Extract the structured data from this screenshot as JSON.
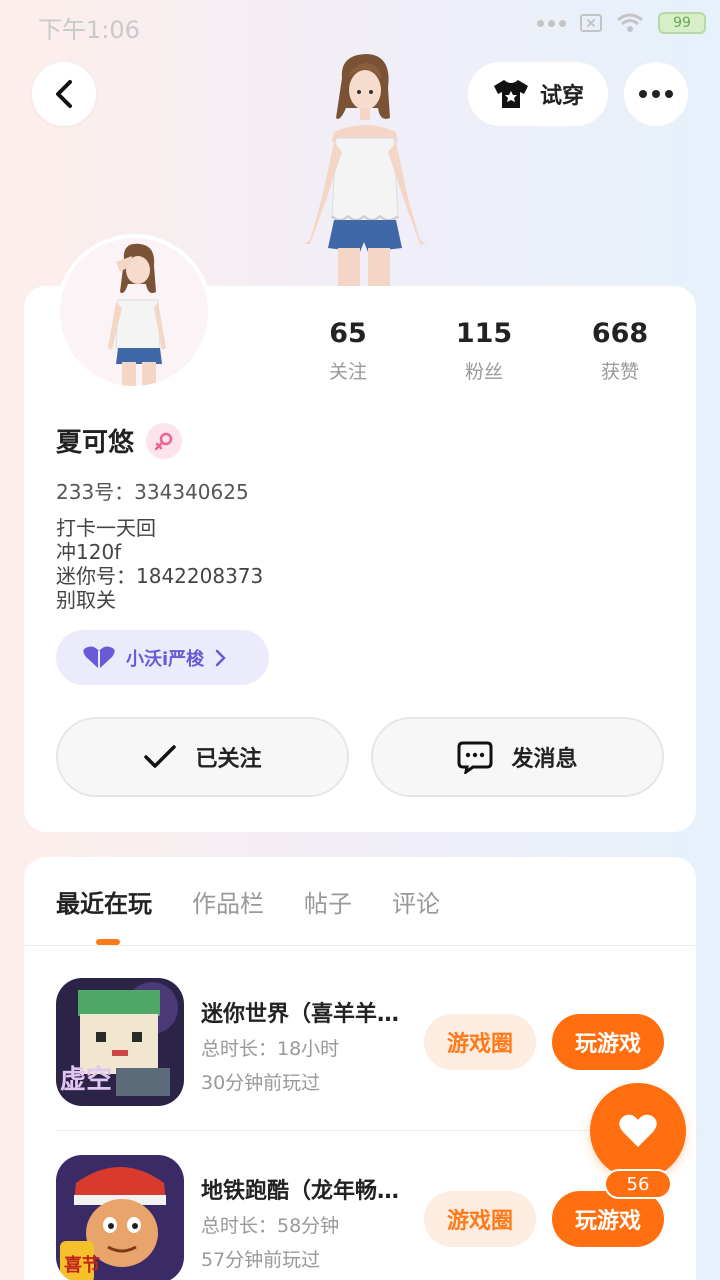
{
  "status_bar": {
    "time": "下午1:06",
    "battery": "99"
  },
  "header": {
    "tryon_label": "试穿"
  },
  "profile": {
    "stats": [
      {
        "value": "65",
        "label": "关注"
      },
      {
        "value": "115",
        "label": "粉丝"
      },
      {
        "value": "668",
        "label": "获赞"
      }
    ],
    "username": "夏可悠",
    "uid": "233号：334340625",
    "bio": [
      "打卡一天回",
      "冲120f",
      "迷你号：1842208373",
      "别取关"
    ],
    "club_label": "小沃i严梭",
    "follow_label": "已关注",
    "message_label": "发消息"
  },
  "tabs": [
    {
      "label": "最近在玩",
      "active": true
    },
    {
      "label": "作品栏",
      "active": false
    },
    {
      "label": "帖子",
      "active": false
    },
    {
      "label": "评论",
      "active": false
    }
  ],
  "games": [
    {
      "title": "迷你世界（喜羊羊…",
      "duration": "总时长：18小时",
      "last_played": "30分钟前玩过",
      "circle_label": "游戏圈",
      "play_label": "玩游戏"
    },
    {
      "title": "地铁跑酷（龙年畅…",
      "duration": "总时长：58分钟",
      "last_played": "57分钟前玩过",
      "circle_label": "游戏圈",
      "play_label": "玩游戏"
    }
  ],
  "like_count": "56",
  "colors": {
    "accent": "#ff6e0f",
    "club": "#6a5ad6"
  }
}
